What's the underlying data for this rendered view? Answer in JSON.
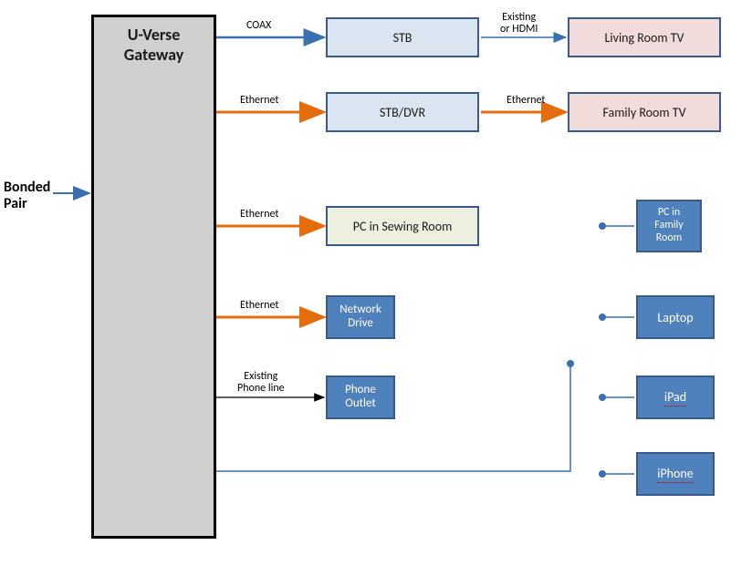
{
  "input": {
    "label": "Bonded\nPair"
  },
  "gateway": {
    "title": "U-Verse Gateway"
  },
  "connections": {
    "coax": "COAX",
    "ethernet1": "Ethernet",
    "ethernet2": "Ethernet",
    "ethernet3": "Ethernet",
    "phone": "Existing\nPhone line",
    "stb_tv": "Existing\nor HDMI",
    "dvr_tv": "Ethernet"
  },
  "nodes": {
    "stb": "STB",
    "dvr": "STB/DVR",
    "sewing_pc": "PC in Sewing Room",
    "net_drive": "Network\nDrive",
    "phone_outlet": "Phone\nOutlet",
    "living_tv": "Living Room TV",
    "family_tv": "Family Room TV",
    "family_pc": "PC in\nFamily\nRoom",
    "laptop": "Laptop",
    "ipad": "iPad",
    "iphone": "iPhone"
  }
}
